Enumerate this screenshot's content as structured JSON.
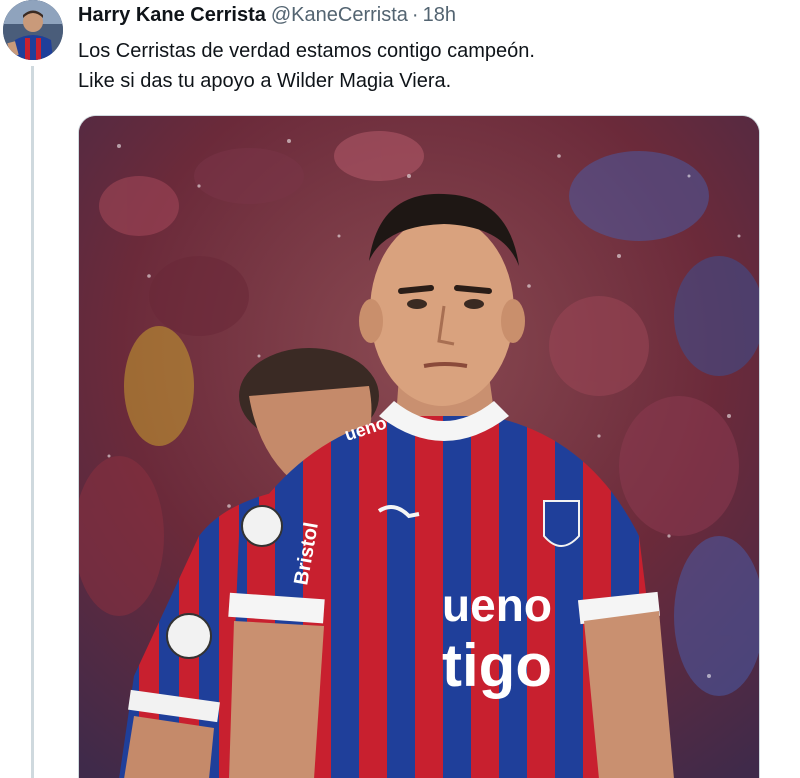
{
  "tweet": {
    "display_name": "Harry Kane Cerrista",
    "handle": "@KaneCerrista",
    "separator": "·",
    "time": "18h",
    "text_lines": [
      "Los Cerristas de verdad estamos contigo campeón.",
      "Like si das tu apoyo a Wilder Magia Viera."
    ]
  },
  "media": {
    "jersey_sponsor_top": "ueno",
    "jersey_sponsor_bottom": "tigo",
    "jersey_collar_brand": "ueno",
    "jersey_sleeve_text": "Bristol",
    "colors": {
      "jersey_red": "#c8202f",
      "jersey_blue": "#1f3f9a",
      "background_crowd": "#6b2a3a"
    }
  }
}
